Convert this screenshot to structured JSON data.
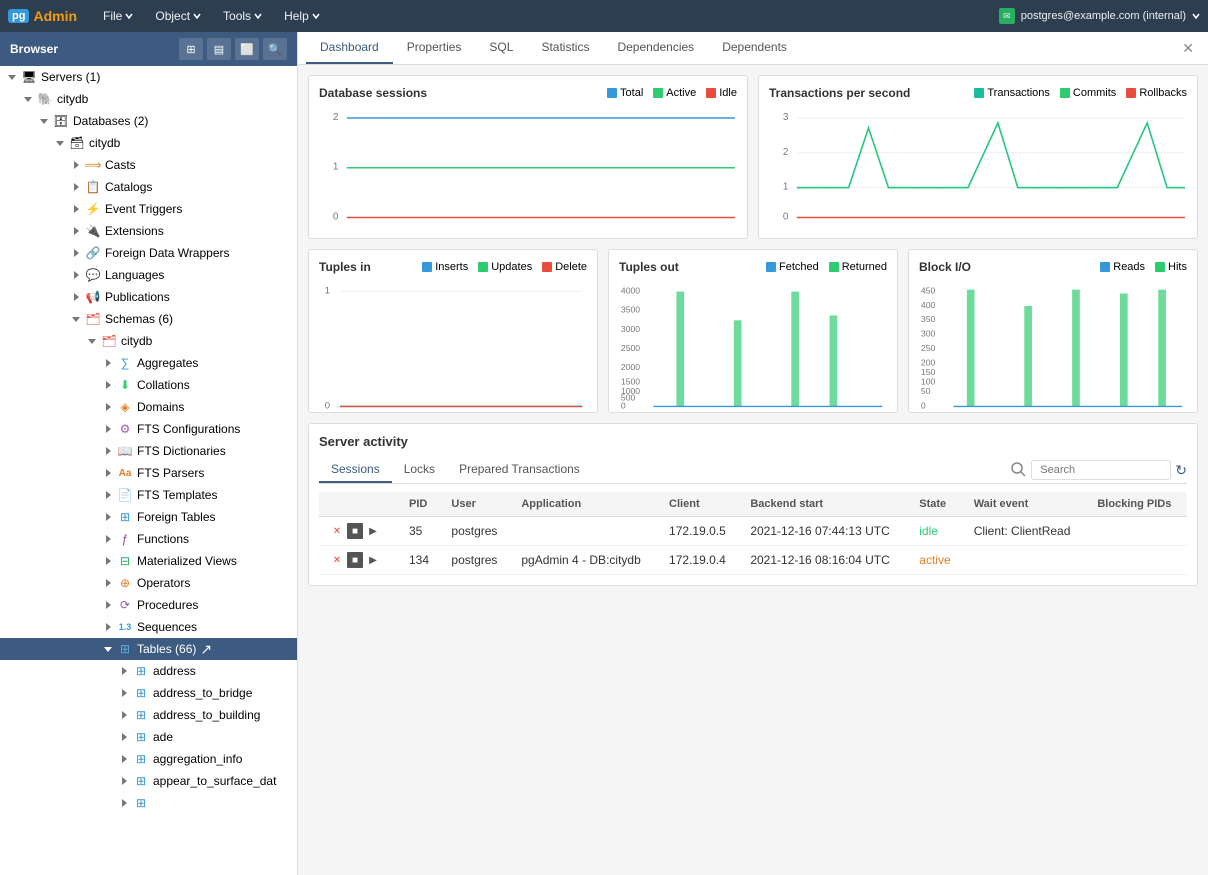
{
  "topbar": {
    "logo": "pgAdmin",
    "menu_items": [
      "File",
      "Object",
      "Tools",
      "Help"
    ],
    "user": "postgres@example.com (internal)"
  },
  "sidebar": {
    "title": "Browser",
    "tree": [
      {
        "id": "servers",
        "label": "Servers (1)",
        "level": 1,
        "expanded": true,
        "icon": "server"
      },
      {
        "id": "citydb_server",
        "label": "citydb",
        "level": 2,
        "expanded": true,
        "icon": "postgres"
      },
      {
        "id": "databases",
        "label": "Databases (2)",
        "level": 3,
        "expanded": true,
        "icon": "databases"
      },
      {
        "id": "citydb_db",
        "label": "citydb",
        "level": 4,
        "expanded": true,
        "icon": "database"
      },
      {
        "id": "casts",
        "label": "Casts",
        "level": 5,
        "expanded": false,
        "icon": "casts"
      },
      {
        "id": "catalogs",
        "label": "Catalogs",
        "level": 5,
        "expanded": false,
        "icon": "catalogs"
      },
      {
        "id": "event_triggers",
        "label": "Event Triggers",
        "level": 5,
        "expanded": false,
        "icon": "event-trigger"
      },
      {
        "id": "extensions",
        "label": "Extensions",
        "level": 5,
        "expanded": false,
        "icon": "extensions"
      },
      {
        "id": "foreign_data_wrappers",
        "label": "Foreign Data Wrappers",
        "level": 5,
        "expanded": false,
        "icon": "fdw"
      },
      {
        "id": "languages",
        "label": "Languages",
        "level": 5,
        "expanded": false,
        "icon": "languages"
      },
      {
        "id": "publications",
        "label": "Publications",
        "level": 5,
        "expanded": false,
        "icon": "publications"
      },
      {
        "id": "schemas",
        "label": "Schemas (6)",
        "level": 5,
        "expanded": true,
        "icon": "schemas"
      },
      {
        "id": "citydb_schema",
        "label": "citydb",
        "level": 6,
        "expanded": true,
        "icon": "schema"
      },
      {
        "id": "aggregates",
        "label": "Aggregates",
        "level": 7,
        "expanded": false,
        "icon": "aggregates"
      },
      {
        "id": "collations",
        "label": "Collations",
        "level": 7,
        "expanded": false,
        "icon": "collations"
      },
      {
        "id": "domains",
        "label": "Domains",
        "level": 7,
        "expanded": false,
        "icon": "domains"
      },
      {
        "id": "fts_configs",
        "label": "FTS Configurations",
        "level": 7,
        "expanded": false,
        "icon": "fts-config"
      },
      {
        "id": "fts_dicts",
        "label": "FTS Dictionaries",
        "level": 7,
        "expanded": false,
        "icon": "fts-dict"
      },
      {
        "id": "fts_parsers",
        "label": "FTS Parsers",
        "level": 7,
        "expanded": false,
        "icon": "fts-parser"
      },
      {
        "id": "fts_templates",
        "label": "FTS Templates",
        "level": 7,
        "expanded": false,
        "icon": "fts-template"
      },
      {
        "id": "foreign_tables",
        "label": "Foreign Tables",
        "level": 7,
        "expanded": false,
        "icon": "foreign-table"
      },
      {
        "id": "functions",
        "label": "Functions",
        "level": 7,
        "expanded": false,
        "icon": "functions"
      },
      {
        "id": "mat_views",
        "label": "Materialized Views",
        "level": 7,
        "expanded": false,
        "icon": "mat-view"
      },
      {
        "id": "operators",
        "label": "Operators",
        "level": 7,
        "expanded": false,
        "icon": "operators"
      },
      {
        "id": "procedures",
        "label": "Procedures",
        "level": 7,
        "expanded": false,
        "icon": "procedures"
      },
      {
        "id": "sequences",
        "label": "Sequences",
        "level": 7,
        "expanded": false,
        "icon": "sequences"
      },
      {
        "id": "tables",
        "label": "Tables (66)",
        "level": 7,
        "expanded": true,
        "icon": "tables",
        "selected": true
      },
      {
        "id": "address",
        "label": "address",
        "level": 8,
        "expanded": false,
        "icon": "table"
      },
      {
        "id": "address_to_bridge",
        "label": "address_to_bridge",
        "level": 8,
        "expanded": false,
        "icon": "table"
      },
      {
        "id": "address_to_building",
        "label": "address_to_building",
        "level": 8,
        "expanded": false,
        "icon": "table"
      },
      {
        "id": "ade",
        "label": "ade",
        "level": 8,
        "expanded": false,
        "icon": "table"
      },
      {
        "id": "aggregation_info",
        "label": "aggregation_info",
        "level": 8,
        "expanded": false,
        "icon": "table"
      },
      {
        "id": "appear_to_surface_dat",
        "label": "appear_to_surface_dat",
        "level": 8,
        "expanded": false,
        "icon": "table"
      }
    ]
  },
  "content": {
    "tabs": [
      "Dashboard",
      "Properties",
      "SQL",
      "Statistics",
      "Dependencies",
      "Dependents"
    ],
    "active_tab": "Dashboard"
  },
  "dashboard": {
    "db_sessions": {
      "title": "Database sessions",
      "legend": [
        {
          "label": "Total",
          "color": "#3498db"
        },
        {
          "label": "Active",
          "color": "#2ecc71"
        },
        {
          "label": "Idle",
          "color": "#e74c3c"
        }
      ]
    },
    "transactions": {
      "title": "Transactions per second",
      "legend": [
        {
          "label": "Transactions",
          "color": "#1abc9c"
        },
        {
          "label": "Commits",
          "color": "#2ecc71"
        },
        {
          "label": "Rollbacks",
          "color": "#e74c3c"
        }
      ]
    },
    "tuples_in": {
      "title": "Tuples in",
      "legend": [
        {
          "label": "Inserts",
          "color": "#3498db"
        },
        {
          "label": "Updates",
          "color": "#2ecc71"
        },
        {
          "label": "Delete",
          "color": "#e74c3c"
        }
      ]
    },
    "tuples_out": {
      "title": "Tuples out",
      "legend": [
        {
          "label": "Fetched",
          "color": "#3498db"
        },
        {
          "label": "Returned",
          "color": "#2ecc71"
        }
      ]
    },
    "block_io": {
      "title": "Block I/O",
      "legend": [
        {
          "label": "Reads",
          "color": "#3498db"
        },
        {
          "label": "Hits",
          "color": "#2ecc71"
        }
      ]
    },
    "server_activity": {
      "title": "Server activity",
      "tabs": [
        "Sessions",
        "Locks",
        "Prepared Transactions"
      ],
      "active_tab": "Sessions",
      "search_placeholder": "Search",
      "columns": [
        "PID",
        "User",
        "Application",
        "Client",
        "Backend start",
        "State",
        "Wait event",
        "Blocking PIDs"
      ],
      "rows": [
        {
          "pid": "35",
          "user": "postgres",
          "application": "",
          "client": "172.19.0.5",
          "backend_start": "2021-12-16 07:44:13 UTC",
          "state": "idle",
          "wait_event": "Client: ClientRead",
          "blocking_pids": ""
        },
        {
          "pid": "134",
          "user": "postgres",
          "application": "pgAdmin 4 - DB:citydb",
          "client": "172.19.0.4",
          "backend_start": "2021-12-16 08:16:04 UTC",
          "state": "active",
          "wait_event": "",
          "blocking_pids": ""
        }
      ]
    }
  }
}
